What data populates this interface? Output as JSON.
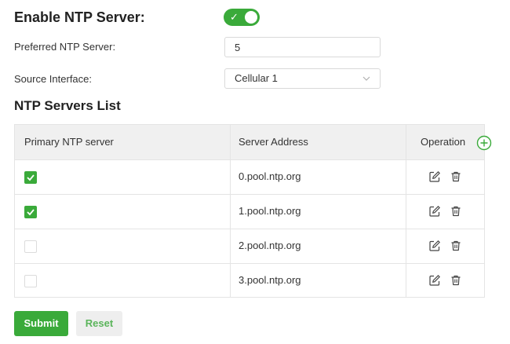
{
  "enable_ntp": {
    "label": "Enable NTP Server:",
    "enabled": true
  },
  "preferred": {
    "label": "Preferred NTP Server:",
    "value": "5"
  },
  "source": {
    "label": "Source Interface:",
    "value": "Cellular 1"
  },
  "list": {
    "title": "NTP Servers List",
    "headers": {
      "primary": "Primary NTP server",
      "address": "Server Address",
      "operation": "Operation"
    },
    "rows": [
      {
        "primary": true,
        "address": "0.pool.ntp.org"
      },
      {
        "primary": true,
        "address": "1.pool.ntp.org"
      },
      {
        "primary": false,
        "address": "2.pool.ntp.org"
      },
      {
        "primary": false,
        "address": "3.pool.ntp.org"
      }
    ]
  },
  "actions": {
    "submit": "Submit",
    "reset": "Reset"
  },
  "colors": {
    "accent": "#3aaa3a",
    "header_bg": "#f0f0f0",
    "reset_text": "#5bb55b"
  },
  "icons": {
    "toggle": "check-icon",
    "select": "chevron-down-icon",
    "add": "add-circle-icon",
    "edit": "edit-icon",
    "delete": "trash-icon",
    "checkbox": "checkmark-icon"
  }
}
